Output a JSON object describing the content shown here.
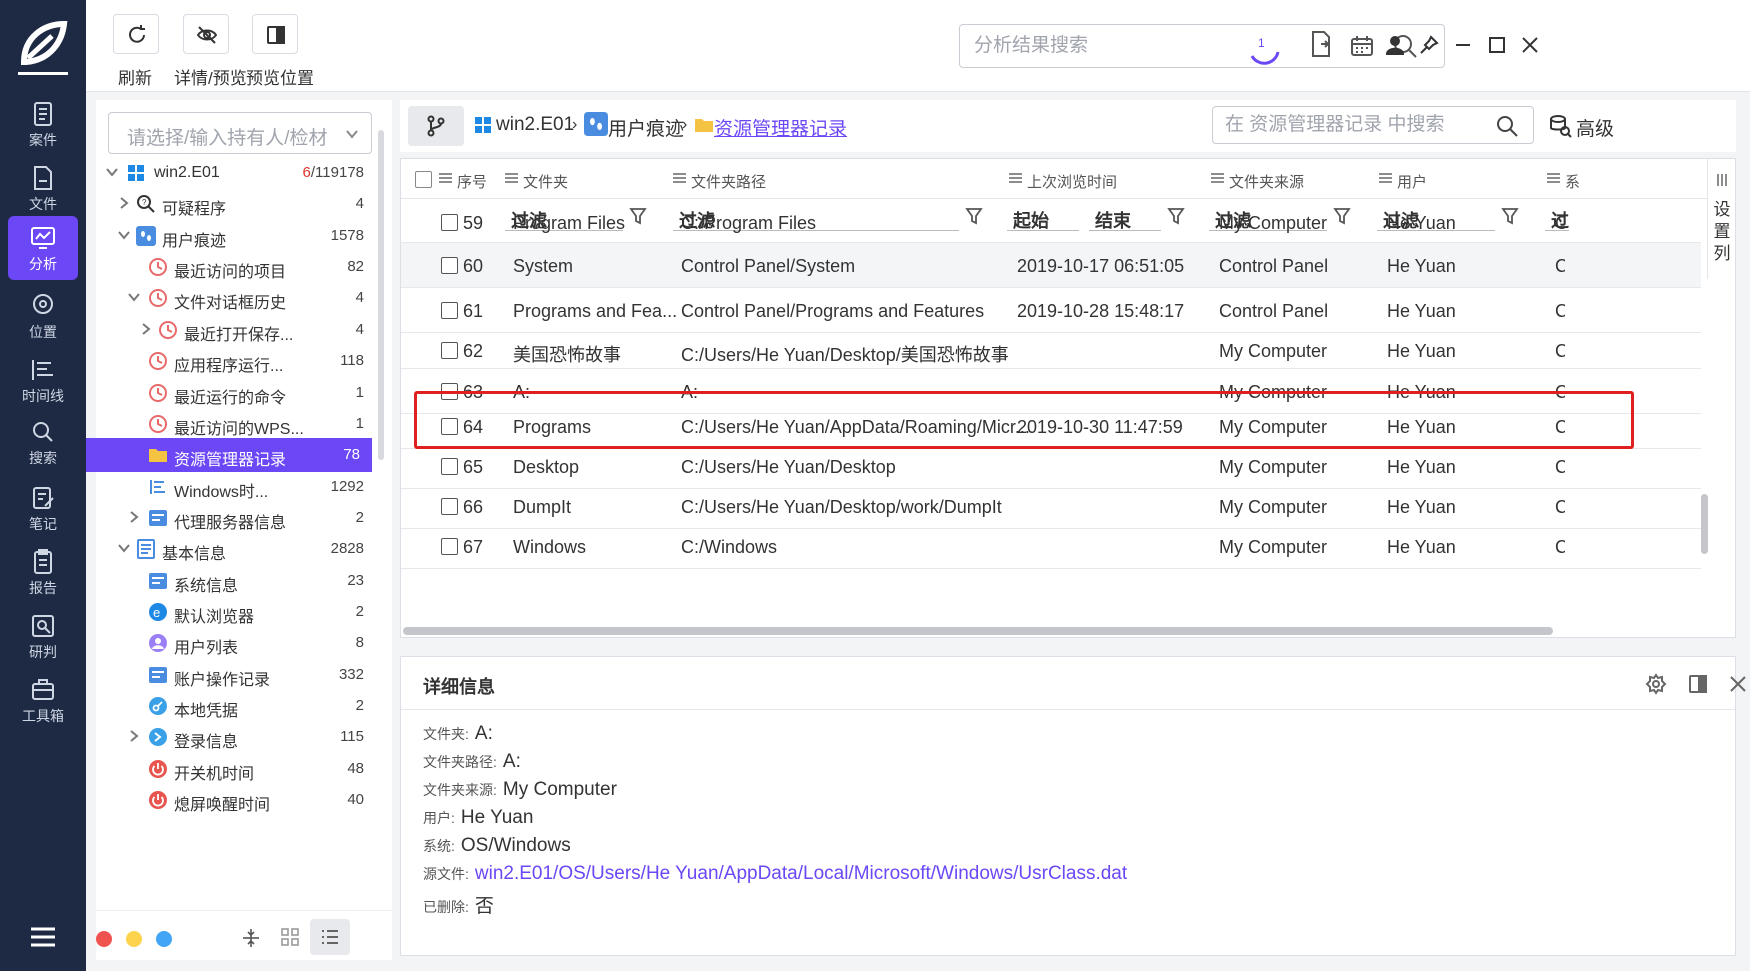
{
  "nav": {
    "items": [
      {
        "label": "案件",
        "icon": "case-icon"
      },
      {
        "label": "文件",
        "icon": "file-icon"
      },
      {
        "label": "分析",
        "icon": "analysis-icon"
      },
      {
        "label": "位置",
        "icon": "location-icon"
      },
      {
        "label": "时间线",
        "icon": "timeline-icon"
      },
      {
        "label": "搜索",
        "icon": "search-icon"
      },
      {
        "label": "笔记",
        "icon": "note-icon"
      },
      {
        "label": "报告",
        "icon": "report-icon"
      },
      {
        "label": "研判",
        "icon": "judge-icon"
      },
      {
        "label": "工具箱",
        "icon": "toolbox-icon"
      }
    ],
    "active": "分析"
  },
  "toolbar": {
    "refresh_label": "刷新",
    "detail_preview_label": "详情/预览",
    "preview_position_label": "预览位置",
    "search_placeholder": "分析结果搜索",
    "task_count": "1"
  },
  "tree": {
    "owner_placeholder": "请选择/输入持有人/检材",
    "items": [
      {
        "label": "win2.E01",
        "count_red": "6",
        "count": "/119178"
      },
      {
        "label": "可疑程序",
        "count": "4"
      },
      {
        "label": "用户痕迹",
        "count": "1578"
      },
      {
        "label": "最近访问的项目",
        "count": "82"
      },
      {
        "label": "文件对话框历史",
        "count": "4"
      },
      {
        "label": "最近打开保存...",
        "count": "4"
      },
      {
        "label": "应用程序运行...",
        "count": "118"
      },
      {
        "label": "最近运行的命令",
        "count": "1"
      },
      {
        "label": "最近访问的WPS...",
        "count": "1"
      },
      {
        "label": "资源管理器记录",
        "count": "78"
      },
      {
        "label": "Windows时...",
        "count": "1292"
      },
      {
        "label": "代理服务器信息",
        "count": "2"
      },
      {
        "label": "基本信息",
        "count": "2828"
      },
      {
        "label": "系统信息",
        "count": "23"
      },
      {
        "label": "默认浏览器",
        "count": "2"
      },
      {
        "label": "用户列表",
        "count": "8"
      },
      {
        "label": "账户操作记录",
        "count": "332"
      },
      {
        "label": "本地凭据",
        "count": "2"
      },
      {
        "label": "登录信息",
        "count": "115"
      },
      {
        "label": "开关机时间",
        "count": "48"
      },
      {
        "label": "熄屏唤醒时间",
        "count": "40"
      }
    ]
  },
  "breadcrumb": {
    "items": [
      "win2.E01",
      "用户痕迹",
      "资源管理器记录"
    ],
    "search_placeholder": "在 资源管理器记录 中搜索",
    "advanced_label": "高级"
  },
  "table": {
    "columns": [
      "序号",
      "文件夹",
      "文件夹路径",
      "上次浏览时间",
      "文件夹来源",
      "用户",
      "系"
    ],
    "filter_label": "过滤",
    "filter_label_short": "过i",
    "start_label": "起始",
    "end_label": "结束",
    "settings_label": "设置列",
    "rows": [
      {
        "no": "59",
        "folder": "Program Files",
        "path": "C:/Program Files",
        "time": "",
        "source": "My Computer",
        "user": "He Yuan",
        "sys": "C"
      },
      {
        "no": "60",
        "folder": "System",
        "path": "Control Panel/System",
        "time": "2019-10-17 06:51:05",
        "source": "Control Panel",
        "user": "He Yuan",
        "sys": "C"
      },
      {
        "no": "61",
        "folder": "Programs and Fea...",
        "path": "Control Panel/Programs and Features",
        "time": "2019-10-28 15:48:17",
        "source": "Control Panel",
        "user": "He Yuan",
        "sys": "C"
      },
      {
        "no": "62",
        "folder": "美国恐怖故事",
        "path": "C:/Users/He Yuan/Desktop/美国恐怖故事",
        "time": "",
        "source": "My Computer",
        "user": "He Yuan",
        "sys": "C"
      },
      {
        "no": "63",
        "folder": "A:",
        "path": "A:",
        "time": "",
        "source": "My Computer",
        "user": "He Yuan",
        "sys": "C"
      },
      {
        "no": "64",
        "folder": "Programs",
        "path": "C:/Users/He Yuan/AppData/Roaming/Micr...",
        "time": "2019-10-30 11:47:59",
        "source": "My Computer",
        "user": "He Yuan",
        "sys": "C"
      },
      {
        "no": "65",
        "folder": "Desktop",
        "path": "C:/Users/He Yuan/Desktop",
        "time": "",
        "source": "My Computer",
        "user": "He Yuan",
        "sys": "C"
      },
      {
        "no": "66",
        "folder": "DumpIt",
        "path": "C:/Users/He Yuan/Desktop/work/DumpIt",
        "time": "",
        "source": "My Computer",
        "user": "He Yuan",
        "sys": "C"
      },
      {
        "no": "67",
        "folder": "Windows",
        "path": "C:/Windows",
        "time": "",
        "source": "My Computer",
        "user": "He Yuan",
        "sys": "C"
      }
    ]
  },
  "details": {
    "title": "详细信息",
    "fields": [
      {
        "label": "文件夹:",
        "value": "A:"
      },
      {
        "label": "文件夹路径:",
        "value": "A:"
      },
      {
        "label": "文件夹来源:",
        "value": "My Computer"
      },
      {
        "label": "用户:",
        "value": "He Yuan"
      },
      {
        "label": "系统:",
        "value": "OS/Windows"
      },
      {
        "label": "源文件:",
        "value": "win2.E01/OS/Users/He Yuan/AppData/Local/Microsoft/Windows/UsrClass.dat"
      },
      {
        "label": "已删除:",
        "value": "否"
      }
    ]
  },
  "colors": {
    "accent": "#6c47f5",
    "nav_bg": "#1e2a44",
    "highlight": "#e02020"
  }
}
